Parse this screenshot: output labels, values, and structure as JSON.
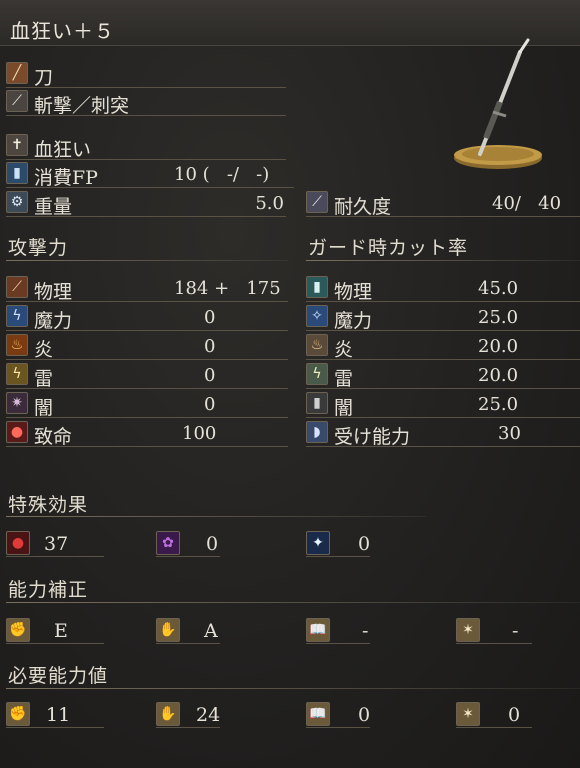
{
  "title": "血狂い＋５",
  "weapon_type": "刀",
  "attack_type": "斬撃／刺突",
  "skill": "血狂い",
  "fp_cost": {
    "label": "消費FP",
    "value": "10 (   -/   -)"
  },
  "weight": {
    "label": "重量",
    "value": "5.0"
  },
  "durability": {
    "label": "耐久度",
    "value": "40/   40"
  },
  "attack": {
    "heading": "攻撃力",
    "rows": [
      {
        "label": "物理",
        "value": "184 +   175",
        "icon": "physical-icon"
      },
      {
        "label": "魔力",
        "value": "0",
        "icon": "magic-icon"
      },
      {
        "label": "炎",
        "value": "0",
        "icon": "fire-icon"
      },
      {
        "label": "雷",
        "value": "0",
        "icon": "lightning-icon"
      },
      {
        "label": "闇",
        "value": "0",
        "icon": "dark-icon"
      },
      {
        "label": "致命",
        "value": "100",
        "icon": "critical-icon"
      }
    ]
  },
  "guard": {
    "heading": "ガード時カット率",
    "rows": [
      {
        "label": "物理",
        "value": "45.0",
        "icon": "physical-guard-icon"
      },
      {
        "label": "魔力",
        "value": "25.0",
        "icon": "magic-guard-icon"
      },
      {
        "label": "炎",
        "value": "20.0",
        "icon": "fire-guard-icon"
      },
      {
        "label": "雷",
        "value": "20.0",
        "icon": "lightning-guard-icon"
      },
      {
        "label": "闇",
        "value": "25.0",
        "icon": "dark-guard-icon"
      },
      {
        "label": "受け能力",
        "value": "30",
        "icon": "stability-icon"
      }
    ]
  },
  "special_effects": {
    "heading": "特殊効果",
    "items": [
      {
        "icon": "bleed-icon",
        "value": "37"
      },
      {
        "icon": "poison-icon",
        "value": "0"
      },
      {
        "icon": "frost-icon",
        "value": "0"
      }
    ]
  },
  "scaling": {
    "heading": "能力補正",
    "items": [
      {
        "icon": "strength-icon",
        "value": "E"
      },
      {
        "icon": "dexterity-icon",
        "value": "A"
      },
      {
        "icon": "intelligence-icon",
        "value": "-"
      },
      {
        "icon": "faith-icon",
        "value": "-"
      }
    ]
  },
  "requirements": {
    "heading": "必要能力値",
    "items": [
      {
        "icon": "strength-req-icon",
        "value": "11"
      },
      {
        "icon": "dexterity-req-icon",
        "value": "24"
      },
      {
        "icon": "intelligence-req-icon",
        "value": "0"
      },
      {
        "icon": "faith-req-icon",
        "value": "0"
      }
    ]
  }
}
